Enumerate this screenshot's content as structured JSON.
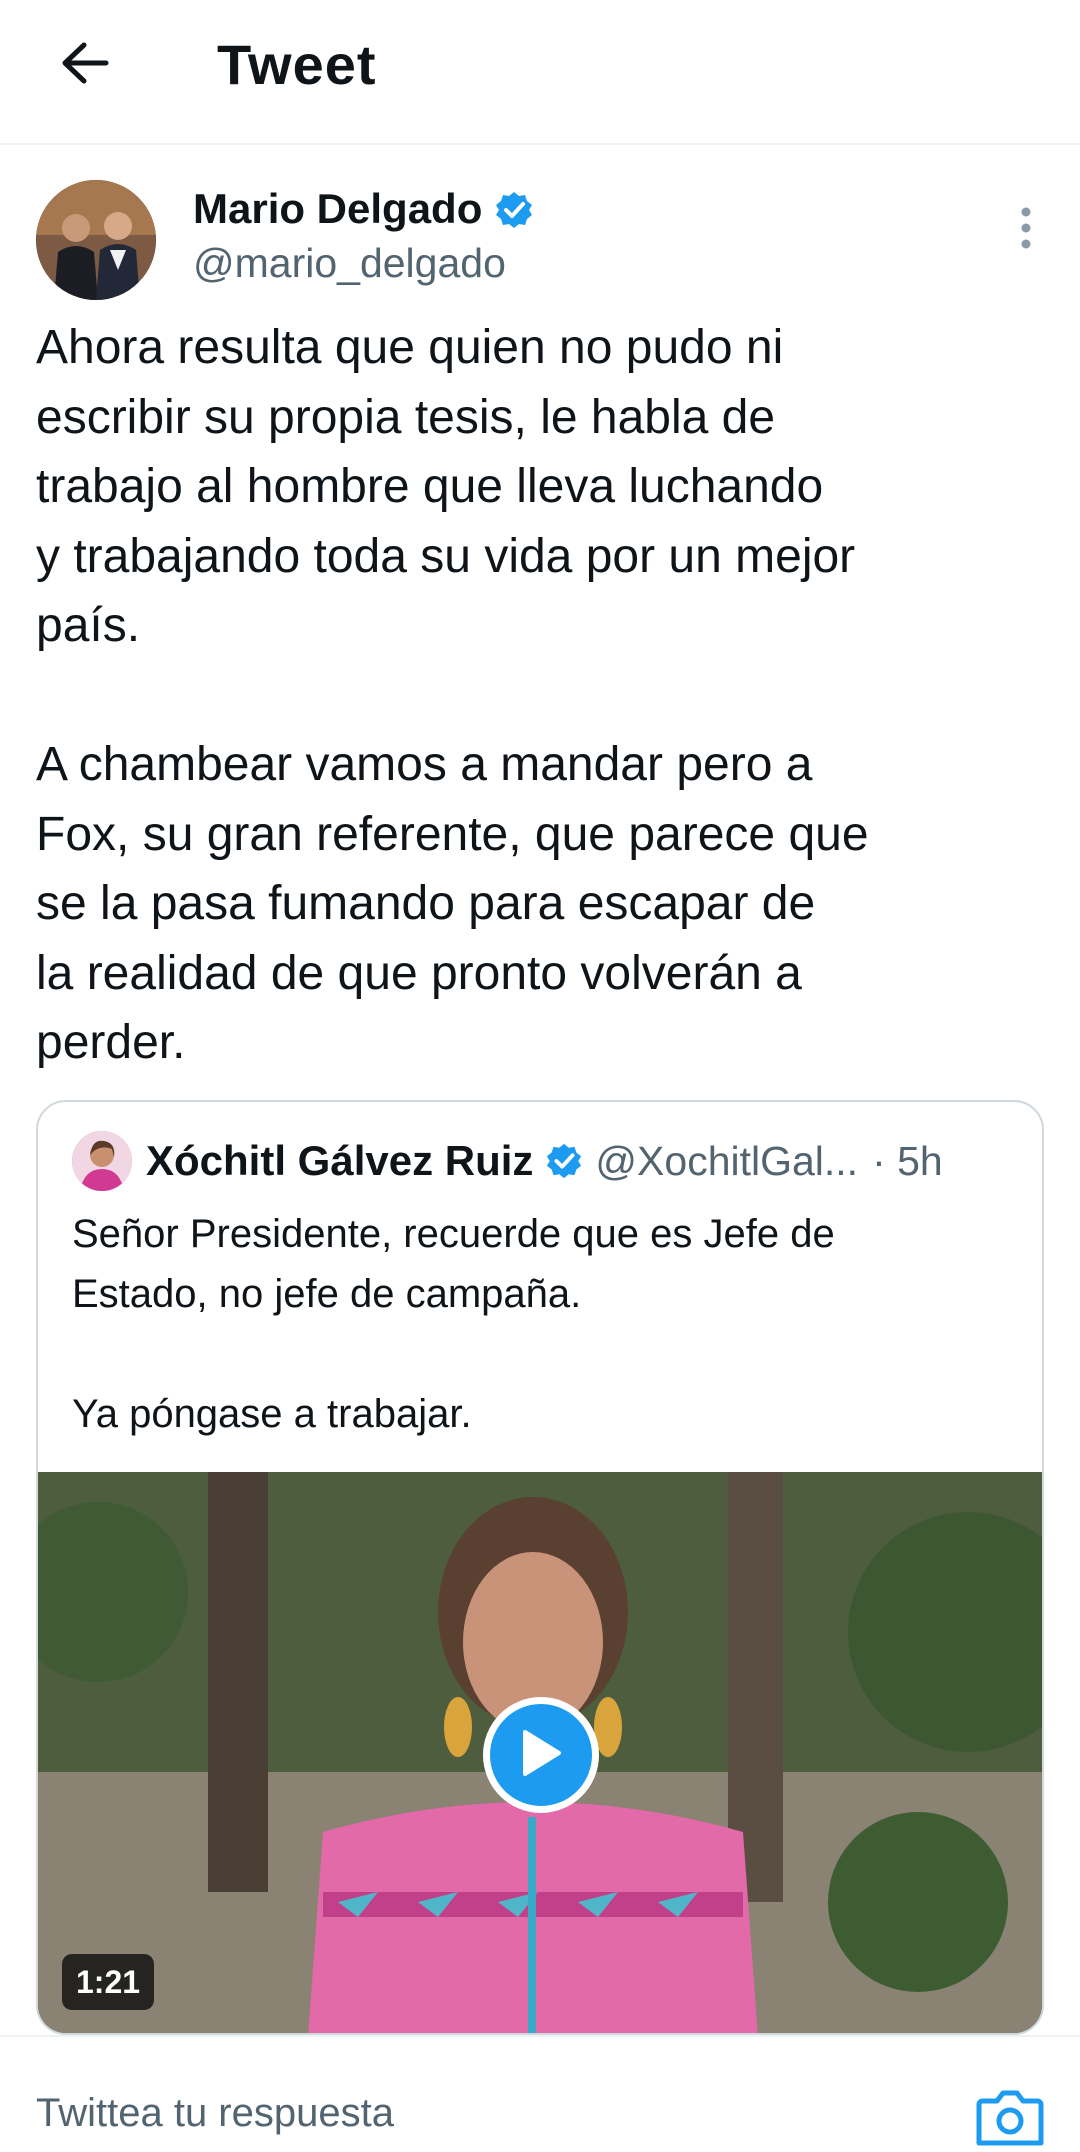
{
  "header": {
    "title": "Tweet",
    "back_icon": "arrow-left-icon"
  },
  "tweet": {
    "author_name": "Mario Delgado",
    "author_handle": "@mario_delgado",
    "verified_icon": "verified-badge-icon",
    "more_icon": "more-vertical-icon",
    "text": "Ahora resulta que quien no pudo ni\nescribir su propia tesis, le habla de\ntrabajo al hombre que lleva luchando\ny trabajando toda su vida por un mejor\npaís.\n\nA chambear vamos a mandar pero a\nFox, su gran referente, que parece que\nse la pasa fumando para escapar de\nla realidad de que pronto volverán a\nperder."
  },
  "quoted_tweet": {
    "author_name": "Xóchitl Gálvez Ruiz",
    "author_handle": "@XochitlGal...",
    "time": "· 5h",
    "text": "Señor Presidente, recuerde que es Jefe de\nEstado, no jefe de campaña.\n\nYa póngase a trabajar.",
    "video_duration": "1:21",
    "play_icon": "play-icon"
  },
  "reply": {
    "placeholder": "Twittea tu respuesta",
    "camera_icon": "camera-icon"
  },
  "colors": {
    "accent": "#1d9bf0",
    "text": "#0f1419",
    "secondary": "#536471",
    "border": "#cfd9de"
  }
}
